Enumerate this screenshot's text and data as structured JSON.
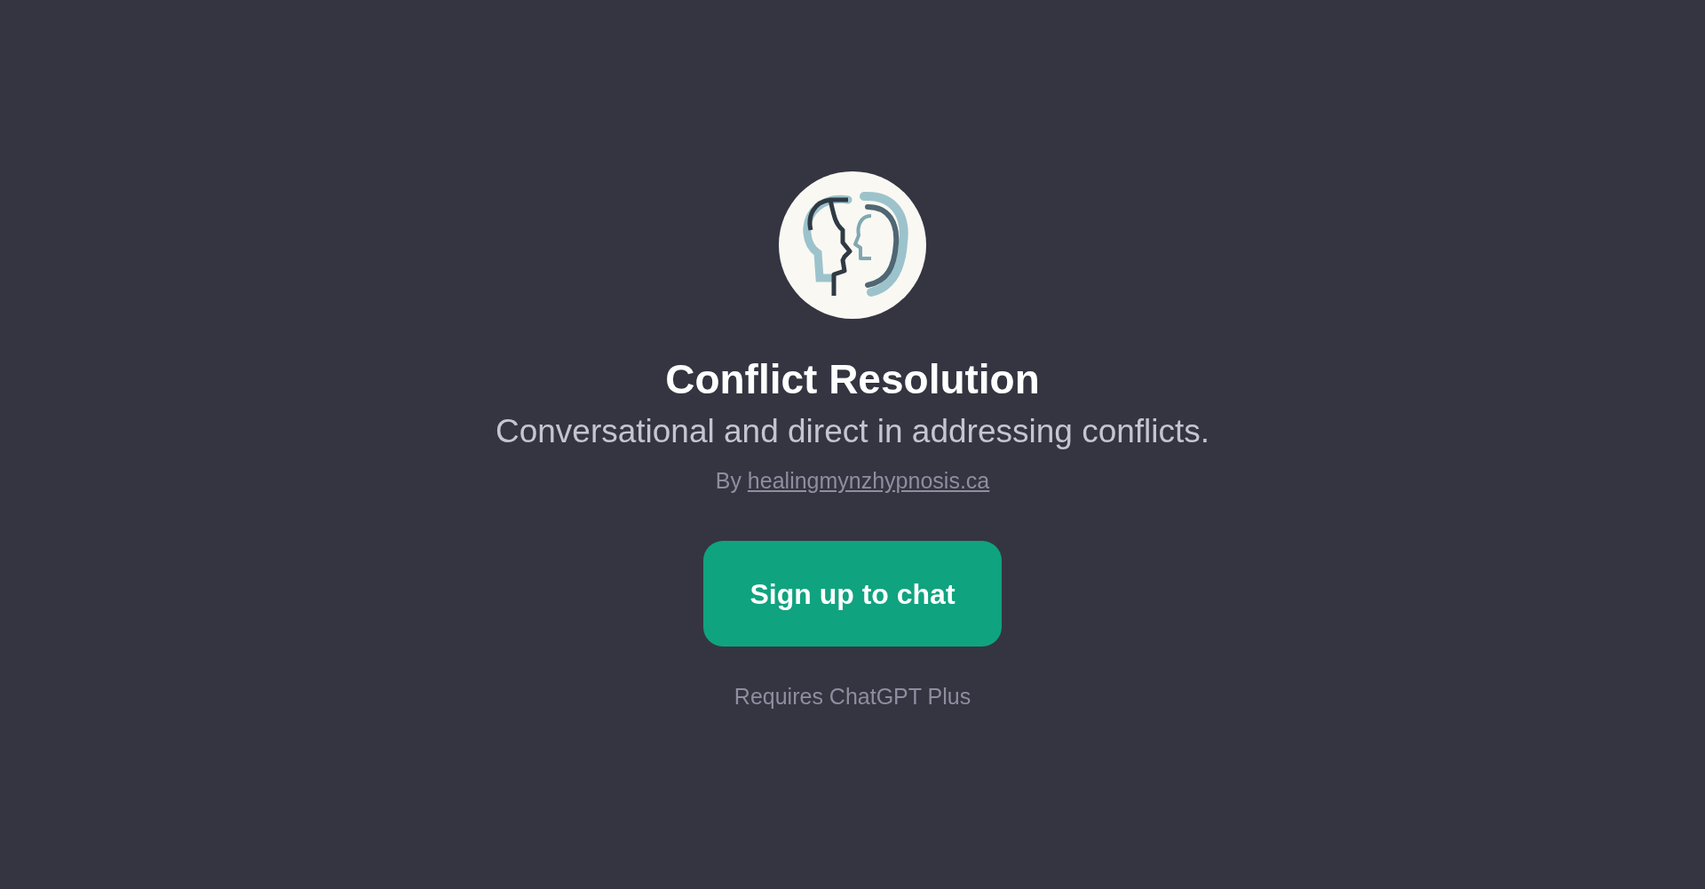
{
  "gpt": {
    "title": "Conflict Resolution",
    "description": "Conversational and direct in addressing conflicts.",
    "author_prefix": "By",
    "author_link": "healingmynzhypnosis.ca"
  },
  "button": {
    "label": "Sign up to chat"
  },
  "note": "Requires ChatGPT Plus"
}
